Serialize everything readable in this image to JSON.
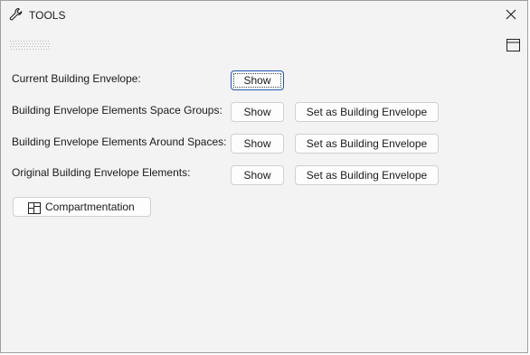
{
  "window": {
    "title": "TOOLS",
    "title_icon": "wrench-icon",
    "close_icon": "close-icon"
  },
  "toolbar": {
    "grip_icon": "grip-dots-icon",
    "layout_icon": "window-layout-icon"
  },
  "rows": [
    {
      "label": "Current Building Envelope:",
      "show_label": "Show"
    },
    {
      "label": "Building Envelope Elements Space Groups:",
      "show_label": "Show",
      "set_label": "Set as Building Envelope"
    },
    {
      "label": "Building Envelope Elements Around Spaces:",
      "show_label": "Show",
      "set_label": "Set as Building Envelope"
    },
    {
      "label": "Original Building Envelope Elements:",
      "show_label": "Show",
      "set_label": "Set as Building Envelope"
    }
  ],
  "compartmentation": {
    "label": "Compartmentation",
    "icon": "compartment-grid-icon"
  }
}
